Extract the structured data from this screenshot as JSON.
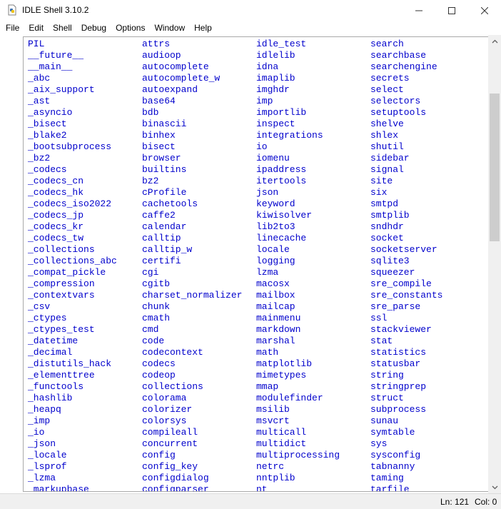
{
  "window": {
    "title": "IDLE Shell 3.10.2",
    "minimize_glyph": "—",
    "maximize_glyph": "☐",
    "close_glyph": "✕"
  },
  "menu": [
    "File",
    "Edit",
    "Shell",
    "Debug",
    "Options",
    "Window",
    "Help"
  ],
  "modules": {
    "col1": [
      "PIL",
      "__future__",
      "__main__",
      "_abc",
      "_aix_support",
      "_ast",
      "_asyncio",
      "_bisect",
      "_blake2",
      "_bootsubprocess",
      "_bz2",
      "_codecs",
      "_codecs_cn",
      "_codecs_hk",
      "_codecs_iso2022",
      "_codecs_jp",
      "_codecs_kr",
      "_codecs_tw",
      "_collections",
      "_collections_abc",
      "_compat_pickle",
      "_compression",
      "_contextvars",
      "_csv",
      "_ctypes",
      "_ctypes_test",
      "_datetime",
      "_decimal",
      "_distutils_hack",
      "_elementtree",
      "_functools",
      "_hashlib",
      "_heapq",
      "_imp",
      "_io",
      "_json",
      "_locale",
      "_lsprof",
      "_lzma",
      "_markupbase"
    ],
    "col2": [
      "attrs",
      "audioop",
      "autocomplete",
      "autocomplete_w",
      "autoexpand",
      "base64",
      "bdb",
      "binascii",
      "binhex",
      "bisect",
      "browser",
      "builtins",
      "bz2",
      "cProfile",
      "cachetools",
      "caffe2",
      "calendar",
      "calltip",
      "calltip_w",
      "certifi",
      "cgi",
      "cgitb",
      "charset_normalizer",
      "chunk",
      "cmath",
      "cmd",
      "code",
      "codecontext",
      "codecs",
      "codeop",
      "collections",
      "colorama",
      "colorizer",
      "colorsys",
      "compileall",
      "concurrent",
      "config",
      "config_key",
      "configdialog",
      "configparser"
    ],
    "col3": [
      "idle_test",
      "idlelib",
      "idna",
      "imaplib",
      "imghdr",
      "imp",
      "importlib",
      "inspect",
      "integrations",
      "io",
      "iomenu",
      "ipaddress",
      "itertools",
      "json",
      "keyword",
      "kiwisolver",
      "lib2to3",
      "linecache",
      "locale",
      "logging",
      "lzma",
      "macosx",
      "mailbox",
      "mailcap",
      "mainmenu",
      "markdown",
      "marshal",
      "math",
      "matplotlib",
      "mimetypes",
      "mmap",
      "modulefinder",
      "msilib",
      "msvcrt",
      "multicall",
      "multidict",
      "multiprocessing",
      "netrc",
      "nntplib",
      "nt"
    ],
    "col4": [
      "search",
      "searchbase",
      "searchengine",
      "secrets",
      "select",
      "selectors",
      "setuptools",
      "shelve",
      "shlex",
      "shutil",
      "sidebar",
      "signal",
      "site",
      "six",
      "smtpd",
      "smtplib",
      "sndhdr",
      "socket",
      "socketserver",
      "sqlite3",
      "squeezer",
      "sre_compile",
      "sre_constants",
      "sre_parse",
      "ssl",
      "stackviewer",
      "stat",
      "statistics",
      "statusbar",
      "string",
      "stringprep",
      "struct",
      "subprocess",
      "sunau",
      "symtable",
      "sys",
      "sysconfig",
      "tabnanny",
      "taming",
      "tarfile"
    ]
  },
  "status": {
    "line": "Ln: 121",
    "col": "Col: 0"
  },
  "colors": {
    "module_text": "#0000cc",
    "background": "#ffffff",
    "scroll_thumb": "#cdcdcd"
  },
  "icons": {
    "app": "python-idle-icon",
    "scroll_up": "chevron-up-icon",
    "scroll_down": "chevron-down-icon"
  }
}
